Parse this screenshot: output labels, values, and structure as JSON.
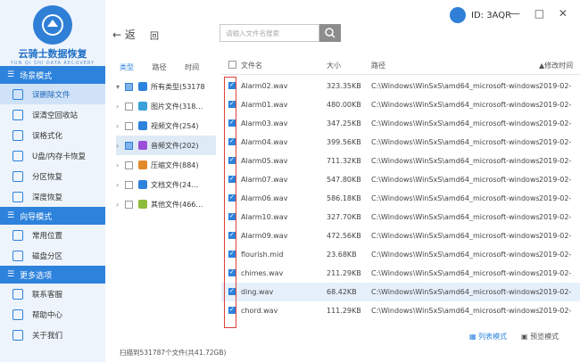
{
  "app": {
    "title": "云骑士数据恢复",
    "subtitle": "YUN QI SHI DATA RECOVERY",
    "id_label": "ID: 3AQR",
    "win_controls": "— □ ✕"
  },
  "sidebar": {
    "sections": [
      {
        "title": "场景模式",
        "items": [
          "误删除文件",
          "误清空回收站",
          "误格式化",
          "U盘/内存卡恢复",
          "分区恢复",
          "深度恢复"
        ]
      },
      {
        "title": "向导模式",
        "items": [
          "常用位置",
          "磁盘分区"
        ]
      },
      {
        "title": "更多选项",
        "items": [
          "联系客服",
          "帮助中心",
          "关于我们"
        ]
      }
    ]
  },
  "topbar": {
    "back_label": "← 返",
    "back2": "回",
    "search_placeholder": "请输入文件名搜索"
  },
  "tree": {
    "headers": [
      "类型",
      "路径",
      "时间"
    ],
    "items": [
      {
        "label": "所有类型(53178",
        "color": "#2d82dc"
      },
      {
        "label": "图片文件(318…",
        "color": "#3aa0d8"
      },
      {
        "label": "视频文件(254)",
        "color": "#2d82dc"
      },
      {
        "label": "音频文件(202)",
        "color": "#9b4fd8"
      },
      {
        "label": "压缩文件(884)",
        "color": "#e08a2a"
      },
      {
        "label": "文档文件(24…",
        "color": "#2d82dc"
      },
      {
        "label": "其他文件(466…",
        "color": "#8dbb3c"
      }
    ]
  },
  "table": {
    "headers": {
      "name": "文件名",
      "size": "大小",
      "path": "路径",
      "time": "修改时间"
    },
    "rows": [
      {
        "name": "Alarm02.wav",
        "size": "323.35KB",
        "path": "C:\\Windows\\WinSxS\\amd64_microsoft-windows...",
        "time": "2019-02-"
      },
      {
        "name": "Alarm01.wav",
        "size": "480.00KB",
        "path": "C:\\Windows\\WinSxS\\amd64_microsoft-windows...",
        "time": "2019-02-"
      },
      {
        "name": "Alarm03.wav",
        "size": "347.25KB",
        "path": "C:\\Windows\\WinSxS\\amd64_microsoft-windows...",
        "time": "2019-02-"
      },
      {
        "name": "Alarm04.wav",
        "size": "399.56KB",
        "path": "C:\\Windows\\WinSxS\\amd64_microsoft-windows...",
        "time": "2019-02-"
      },
      {
        "name": "Alarm05.wav",
        "size": "711.32KB",
        "path": "C:\\Windows\\WinSxS\\amd64_microsoft-windows...",
        "time": "2019-02-"
      },
      {
        "name": "Alarm07.wav",
        "size": "547.80KB",
        "path": "C:\\Windows\\WinSxS\\amd64_microsoft-windows...",
        "time": "2019-02-"
      },
      {
        "name": "Alarm06.wav",
        "size": "586.18KB",
        "path": "C:\\Windows\\WinSxS\\amd64_microsoft-windows...",
        "time": "2019-02-"
      },
      {
        "name": "Alarm10.wav",
        "size": "327.70KB",
        "path": "C:\\Windows\\WinSxS\\amd64_microsoft-windows...",
        "time": "2019-02-"
      },
      {
        "name": "Alarm09.wav",
        "size": "472.56KB",
        "path": "C:\\Windows\\WinSxS\\amd64_microsoft-windows...",
        "time": "2019-02-"
      },
      {
        "name": "flourish.mid",
        "size": "23.68KB",
        "path": "C:\\Windows\\WinSxS\\amd64_microsoft-windows...",
        "time": "2019-02-"
      },
      {
        "name": "chimes.wav",
        "size": "211.29KB",
        "path": "C:\\Windows\\WinSxS\\amd64_microsoft-windows...",
        "time": "2019-02-"
      },
      {
        "name": "ding.wav",
        "size": "68.42KB",
        "path": "C:\\Windows\\WinSxS\\amd64_microsoft-windows...",
        "time": "2019-02-"
      },
      {
        "name": "chord.wav",
        "size": "111.29KB",
        "path": "C:\\Windows\\WinSxS\\amd64_microsoft-windows...",
        "time": "2019-02-"
      }
    ]
  },
  "status": {
    "scan_text": "扫描到531787个文件(共41.72GB)",
    "list_mode": "列表模式",
    "preview_mode": "预览模式"
  }
}
